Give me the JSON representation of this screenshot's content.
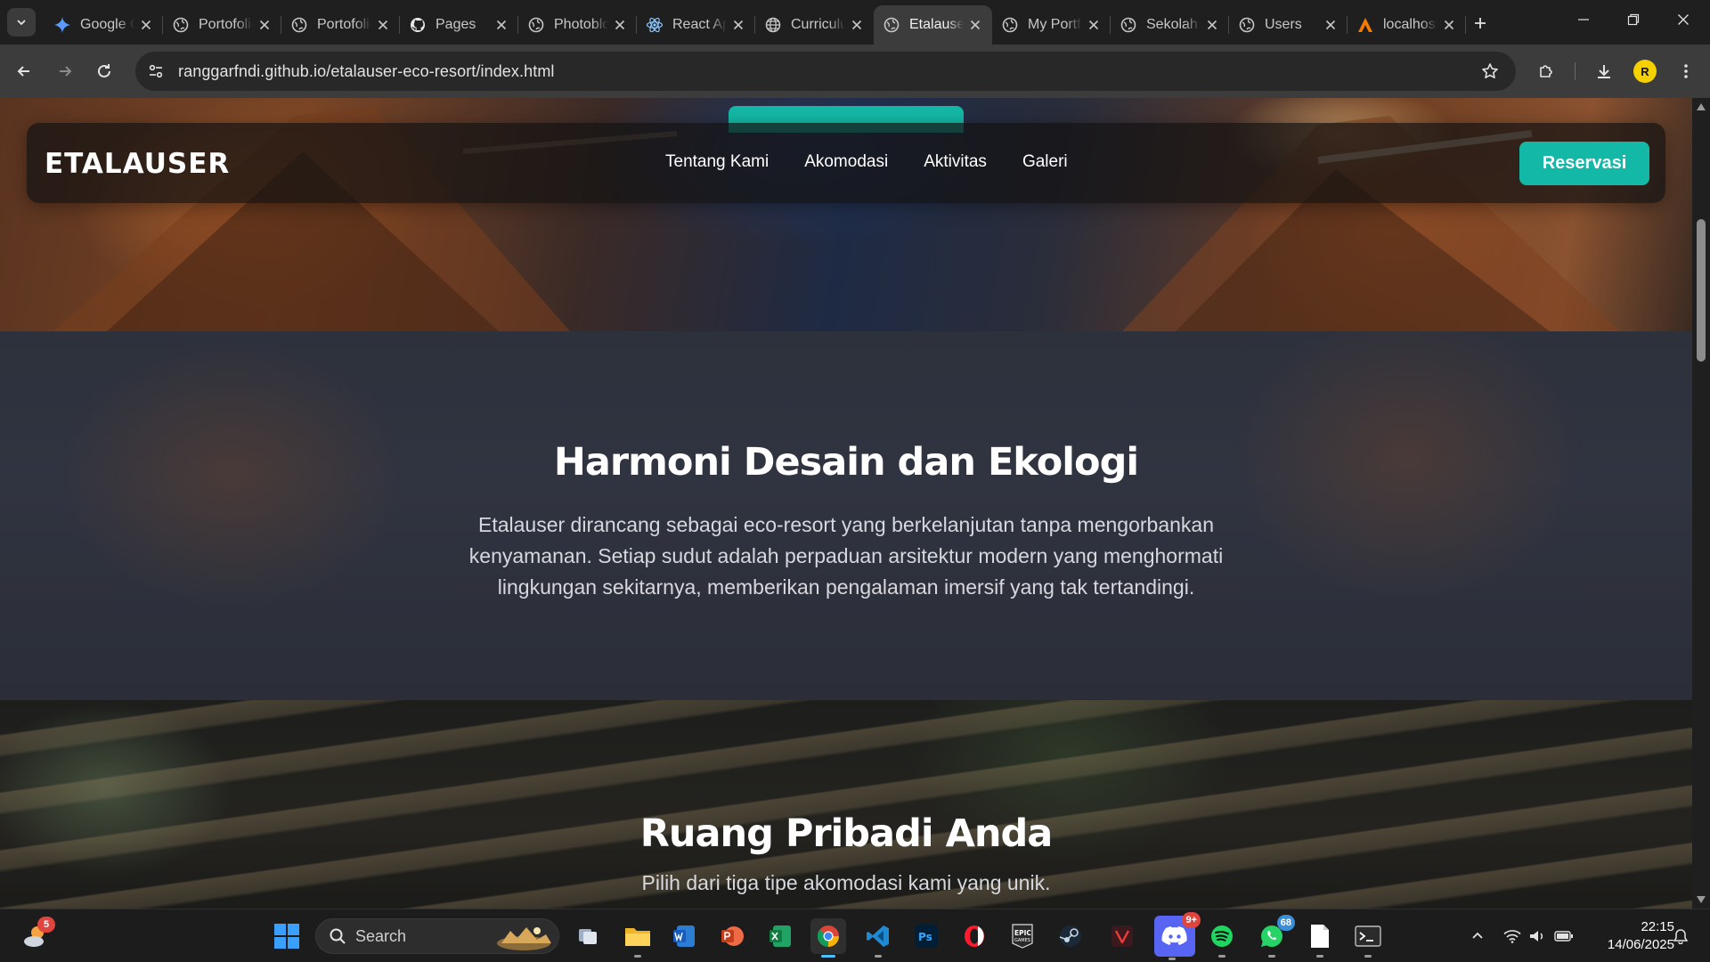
{
  "browser": {
    "tabs": [
      {
        "title": "Google Gemini",
        "favicon": "gemini-icon",
        "active": false
      },
      {
        "title": "Portofolio",
        "favicon": "globe-icon",
        "active": false
      },
      {
        "title": "Portofolio",
        "favicon": "globe-icon",
        "active": false
      },
      {
        "title": "Pages",
        "favicon": "github-icon",
        "active": false
      },
      {
        "title": "Photoblog",
        "favicon": "globe-icon",
        "active": false
      },
      {
        "title": "React App",
        "favicon": "react-icon",
        "active": false
      },
      {
        "title": "Curriculum",
        "favicon": "world-icon",
        "active": false
      },
      {
        "title": "Etalauser",
        "favicon": "globe-icon",
        "active": true
      },
      {
        "title": "My Portfolio",
        "favicon": "globe-icon",
        "active": false
      },
      {
        "title": "Sekolah",
        "favicon": "globe-icon",
        "active": false
      },
      {
        "title": "Users",
        "favicon": "globe-icon",
        "active": false
      },
      {
        "title": "localhost",
        "favicon": "xampp-icon",
        "active": false
      }
    ],
    "url": "ranggarfndi.github.io/etalauser-eco-resort/index.html",
    "profile_initial": "R"
  },
  "site": {
    "brand": "ETALAUSER",
    "nav": [
      "Tentang Kami",
      "Akomodasi",
      "Aktivitas",
      "Galeri"
    ],
    "cta": "Reservasi",
    "accent_color": "#14b8a6",
    "about": {
      "title": "Harmoni Desain dan Ekologi",
      "description": "Etalauser dirancang sebagai eco-resort yang berkelanjutan tanpa mengorbankan kenyamanan. Setiap sudut adalah perpaduan arsitektur modern yang menghormati lingkungan sekitarnya, memberikan pengalaman imersif yang tak tertandingi."
    },
    "accommodation": {
      "title": "Ruang Pribadi Anda",
      "subtitle": "Pilih dari tiga tipe akomodasi kami yang unik."
    }
  },
  "taskbar": {
    "weather_badge": "5",
    "search_placeholder": "Search",
    "apps": [
      {
        "name": "task-view",
        "active": false
      },
      {
        "name": "file-explorer",
        "active": false
      },
      {
        "name": "word",
        "active": false
      },
      {
        "name": "powerpoint",
        "active": false
      },
      {
        "name": "excel",
        "active": false
      },
      {
        "name": "chrome",
        "active": true
      },
      {
        "name": "vscode",
        "active": false
      },
      {
        "name": "photoshop",
        "active": false
      },
      {
        "name": "opera",
        "active": false
      },
      {
        "name": "epic-games",
        "active": false
      },
      {
        "name": "steam",
        "active": false
      },
      {
        "name": "vivaldi",
        "active": false
      },
      {
        "name": "discord",
        "active": false,
        "badge": "9+"
      },
      {
        "name": "spotify",
        "active": false
      },
      {
        "name": "whatsapp",
        "active": false,
        "badge": "68"
      },
      {
        "name": "notepad",
        "active": false
      },
      {
        "name": "terminal",
        "active": false
      }
    ],
    "time": "22:15",
    "date": "14/06/2025"
  }
}
